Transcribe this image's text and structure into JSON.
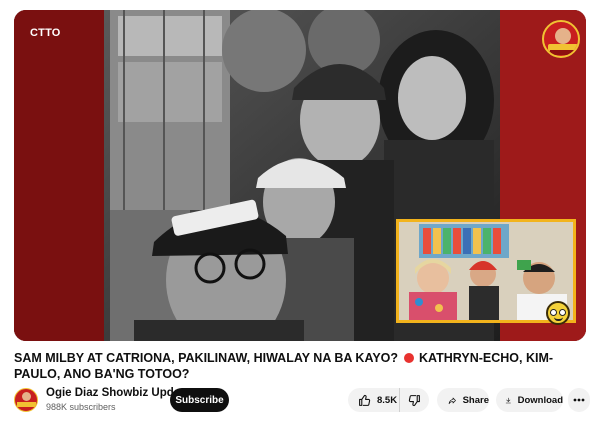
{
  "video": {
    "watermark": "CTTO",
    "channel_logo_icon": "channel-logo-icon",
    "pip_icon": "picture-in-picture-video",
    "emoji_icon": "googly-eyes-emoji-icon"
  },
  "title": {
    "part1": "SAM MILBY AT CATRIONA, PAKILINAW, HIWALAY NA BA KAYO?",
    "part2": "KATHRYN-ECHO, KIM-PAULO, ANO BA'NG TOTOO?",
    "separator_icon": "red-circle-icon",
    "separator_color": "#e8322f"
  },
  "channel": {
    "name": "Ogie Diaz Showbiz Update",
    "subscribers": "988K subscribers",
    "subscribe_label": "Subscribe"
  },
  "actions": {
    "likes": "8.5K",
    "share_label": "Share",
    "download_label": "Download",
    "icons": [
      "thumbs-up-icon",
      "thumbs-down-icon",
      "share-icon",
      "download-icon",
      "more-icon"
    ]
  },
  "colors": {
    "subscribe_bg": "#0f0f0f",
    "pill_bg": "#f2f2f2",
    "pip_border": "#f2b31c"
  }
}
